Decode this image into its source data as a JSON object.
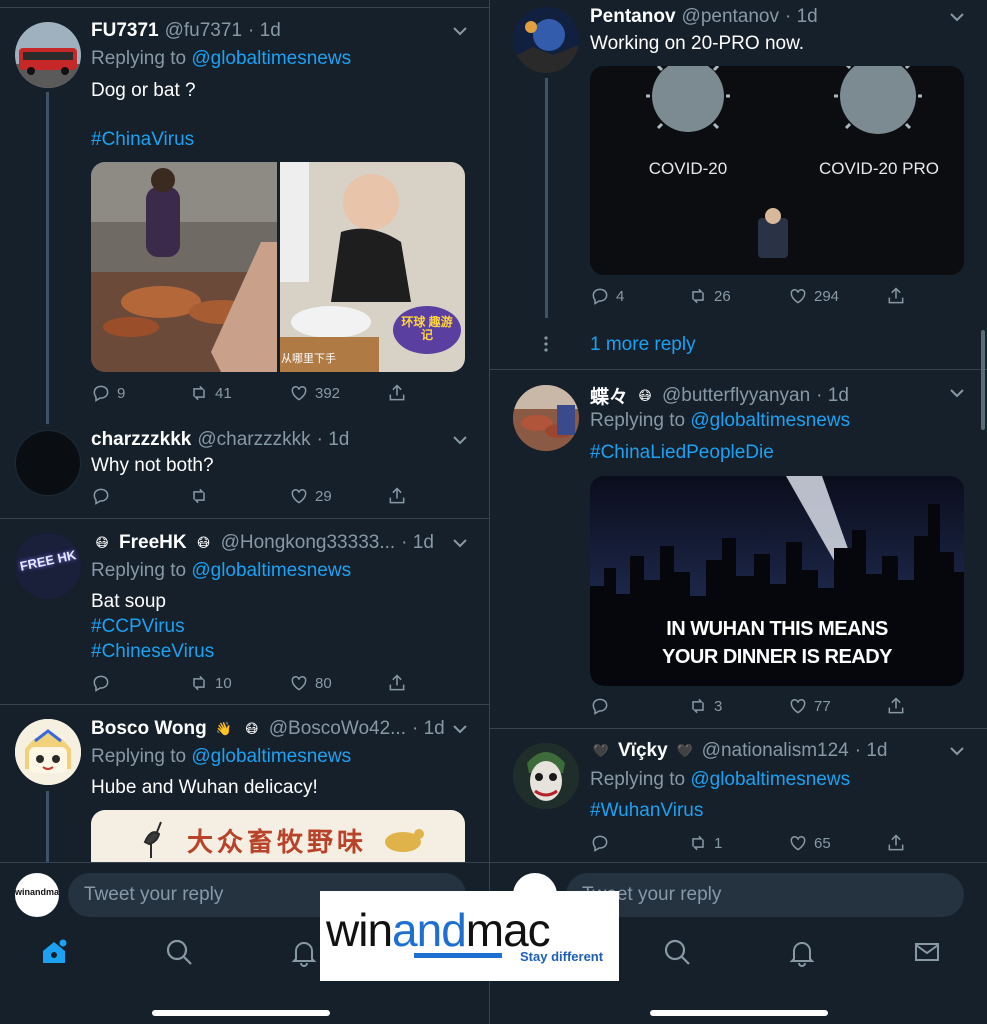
{
  "left": {
    "tweets": [
      {
        "name": "FU7371",
        "handle": "@fu7371",
        "time": "· 1d",
        "replying_prefix": "Replying to",
        "replying_to": "@globaltimesnews",
        "text": "Dog or bat ?",
        "hashtag": "#ChinaVirus",
        "counts": {
          "reply": "9",
          "retweet": "41",
          "like": "392"
        }
      },
      {
        "name": "charzzzkkk",
        "handle": "@charzzzkkk",
        "time": "· 1d",
        "text": "Why not both?",
        "counts": {
          "reply": "",
          "retweet": "",
          "like": "29"
        }
      },
      {
        "emoji_left": "😷",
        "name": "FreeHK",
        "emoji_right": "😷",
        "handle": "@Hongkong33333...",
        "time": "· 1d",
        "replying_prefix": "Replying to",
        "replying_to": "@globaltimesnews",
        "text": "Bat soup",
        "hashtag1": "#CCPVirus",
        "hashtag2": "#ChineseVirus",
        "counts": {
          "reply": "",
          "retweet": "10",
          "like": "80"
        }
      },
      {
        "name": "Bosco Wong",
        "emoji1": "👋",
        "emoji2": "😷",
        "handle": "@BoscoWo42...",
        "time": "· 1d",
        "replying_prefix": "Replying to",
        "replying_to": "@globaltimesnews",
        "text": "Hube and Wuhan delicacy!",
        "media_text": "大众畜牧野味"
      }
    ],
    "avatar_texts": {
      "freehk": "FREE HK"
    },
    "media_texts": {
      "tv_logo": "环球 趣游记",
      "subtitle": "从哪里下手"
    },
    "reply_placeholder": "Tweet your reply",
    "reply_avatar_text": "winandmac"
  },
  "right": {
    "tweets": [
      {
        "name": "Pentanov",
        "handle": "@pentanov",
        "time": "· 1d",
        "text": "Working on 20-PRO now.",
        "media_label_1": "COVID-20",
        "media_label_2": "COVID-20 PRO",
        "counts": {
          "reply": "4",
          "retweet": "26",
          "like": "294"
        },
        "more": "1 more reply"
      },
      {
        "name": "蝶々",
        "emoji": "😷",
        "handle": "@butterflyyanyan",
        "time": "· 1d",
        "replying_prefix": "Replying to",
        "replying_to": "@globaltimesnews",
        "hashtag": "#ChinaLiedPeopleDie",
        "media_line1": "IN WUHAN THIS MEANS",
        "media_line2": "YOUR DINNER IS READY",
        "counts": {
          "reply": "",
          "retweet": "3",
          "like": "77"
        }
      },
      {
        "heart_left": "🖤",
        "name": "Vïçky",
        "heart_right": "🖤",
        "handle": "@nationalism124",
        "time": "· 1d",
        "replying_prefix": "Replying to",
        "replying_to": "@globaltimesnews",
        "hashtag": "#WuhanVirus",
        "counts": {
          "reply": "",
          "retweet": "1",
          "like": "65"
        }
      }
    ],
    "reply_placeholder": "Tweet your reply"
  },
  "watermark": {
    "brand_prefix": "win",
    "brand_mid": "and",
    "brand_suffix": "mac",
    "tagline": "Stay different"
  },
  "colors": {
    "background": "#15202b",
    "accent": "#1da1f2",
    "muted": "#8899a6",
    "divider": "#38444d"
  }
}
